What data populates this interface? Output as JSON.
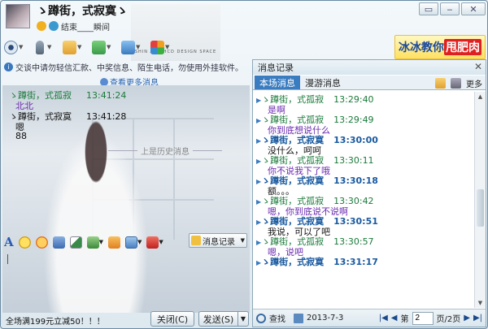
{
  "window": {
    "contact_name": "ゝ蹲街，式寂寞ゝ",
    "status_text": "结束____瞬间",
    "banner_text": "SHIN AN RHCD DESIGN        SPACE",
    "controls": {
      "restore": "▭",
      "minimize": "‒",
      "close": "✕"
    }
  },
  "ad": {
    "part1": "冰冰教你",
    "part2": "甩肥肉"
  },
  "left": {
    "notice": "交谈中请勿轻信汇款、中奖信息、陌生电话，勿使用外挂软件。",
    "more_link": "查看更多消息",
    "chat": [
      {
        "sender": "ゝ蹲街，式孤寂",
        "time": "13:41:24",
        "text": "北北",
        "mine": false
      },
      {
        "sender": "ゝ蹲街，式寂寞",
        "time": "13:41:28",
        "text": "嗯",
        "mine": true
      },
      {
        "text": "88",
        "mine": true
      }
    ],
    "prev_sep": "上是历史消息",
    "msg_record_label": "消息记录",
    "ad_link": "全场满199元立减50！！！",
    "close_label": "关闭(C)",
    "send_label": "发送(S)",
    "send_arrow": "▼"
  },
  "history": {
    "title": "消息记录",
    "close": "✕",
    "tabs": [
      "本场消息",
      "漫游消息"
    ],
    "more": "更多",
    "entries": [
      {
        "name": "ゝ蹲街，式孤寂",
        "time": "13:29:40",
        "text": "是啊",
        "me": false
      },
      {
        "name": "ゝ蹲街，式孤寂",
        "time": "13:29:49",
        "text": "你到底想说什么",
        "me": false
      },
      {
        "name": "ゝ蹲街，式寂寞",
        "time": "13:30:00",
        "text": "没什么，呵呵",
        "me": true
      },
      {
        "name": "ゝ蹲街，式孤寂",
        "time": "13:30:11",
        "text": "你不说我下了哦",
        "me": false
      },
      {
        "name": "ゝ蹲街，式寂寞",
        "time": "13:30:18",
        "text": "额。。。",
        "me": true
      },
      {
        "name": "ゝ蹲街，式孤寂",
        "time": "13:30:42",
        "text": "嗯，你到底说不说啊",
        "me": false
      },
      {
        "name": "ゝ蹲街，式寂寞",
        "time": "13:30:51",
        "text": "我说，可以了吧",
        "me": true
      },
      {
        "name": "ゝ蹲街，式孤寂",
        "time": "13:30:57",
        "text": "嗯，说吧",
        "me": false
      },
      {
        "name": "ゝ蹲街，式寂寞",
        "time": "13:31:17",
        "text": "",
        "me": true
      }
    ],
    "footer": {
      "search": "查找",
      "date": "2013-7-3",
      "nav_first": "|◀",
      "nav_prev": "◀",
      "page_label": "第",
      "page_value": "2",
      "page_total": "页/2页",
      "nav_next": "▶",
      "nav_last": "▶|"
    }
  }
}
